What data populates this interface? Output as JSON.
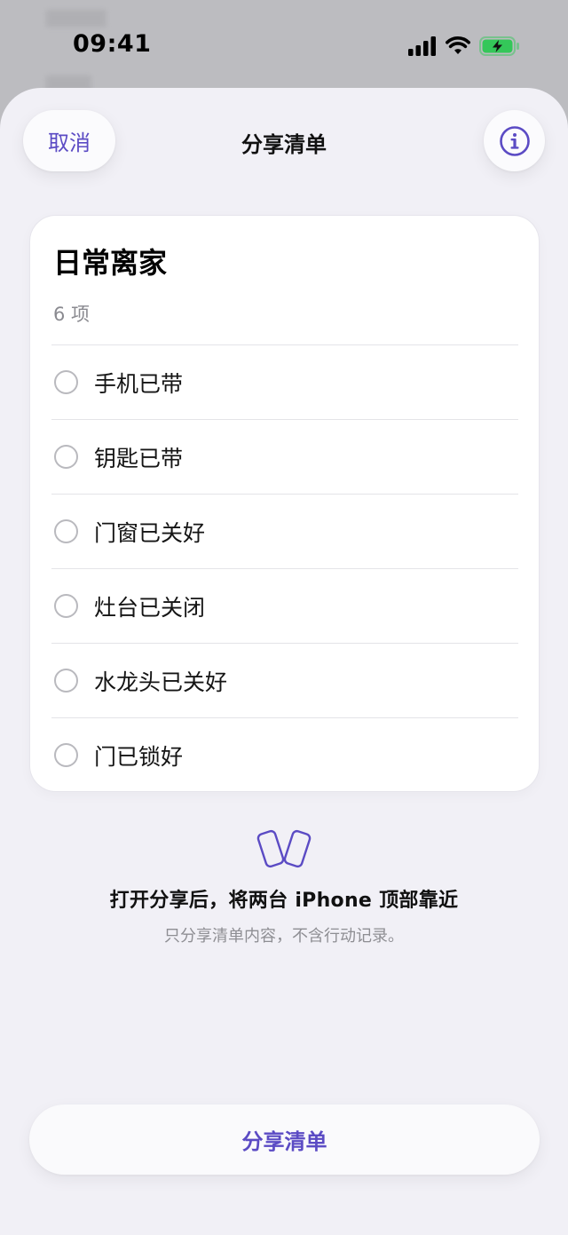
{
  "status_bar": {
    "time": "09:41"
  },
  "sheet": {
    "cancel_label": "取消",
    "title": "分享清单"
  },
  "checklist": {
    "title": "日常离家",
    "count": "6 项",
    "items": [
      {
        "label": "手机已带",
        "checked": false
      },
      {
        "label": "钥匙已带",
        "checked": false
      },
      {
        "label": "门窗已关好",
        "checked": false
      },
      {
        "label": "灶台已关闭",
        "checked": false
      },
      {
        "label": "水龙头已关好",
        "checked": false
      },
      {
        "label": "门已锁好",
        "checked": false
      }
    ]
  },
  "hint": {
    "main": "打开分享后，将两台 iPhone 顶部靠近",
    "sub": "只分享清单内容，不含行动记录。"
  },
  "share_button_label": "分享清单",
  "colors": {
    "accent": "#5b4bc4",
    "battery": "#34c759",
    "sheet_bg": "#f1f0f6"
  },
  "icons": [
    "signal-icon",
    "wifi-icon",
    "battery-charging-icon",
    "info-icon",
    "phones-nearby-icon"
  ]
}
